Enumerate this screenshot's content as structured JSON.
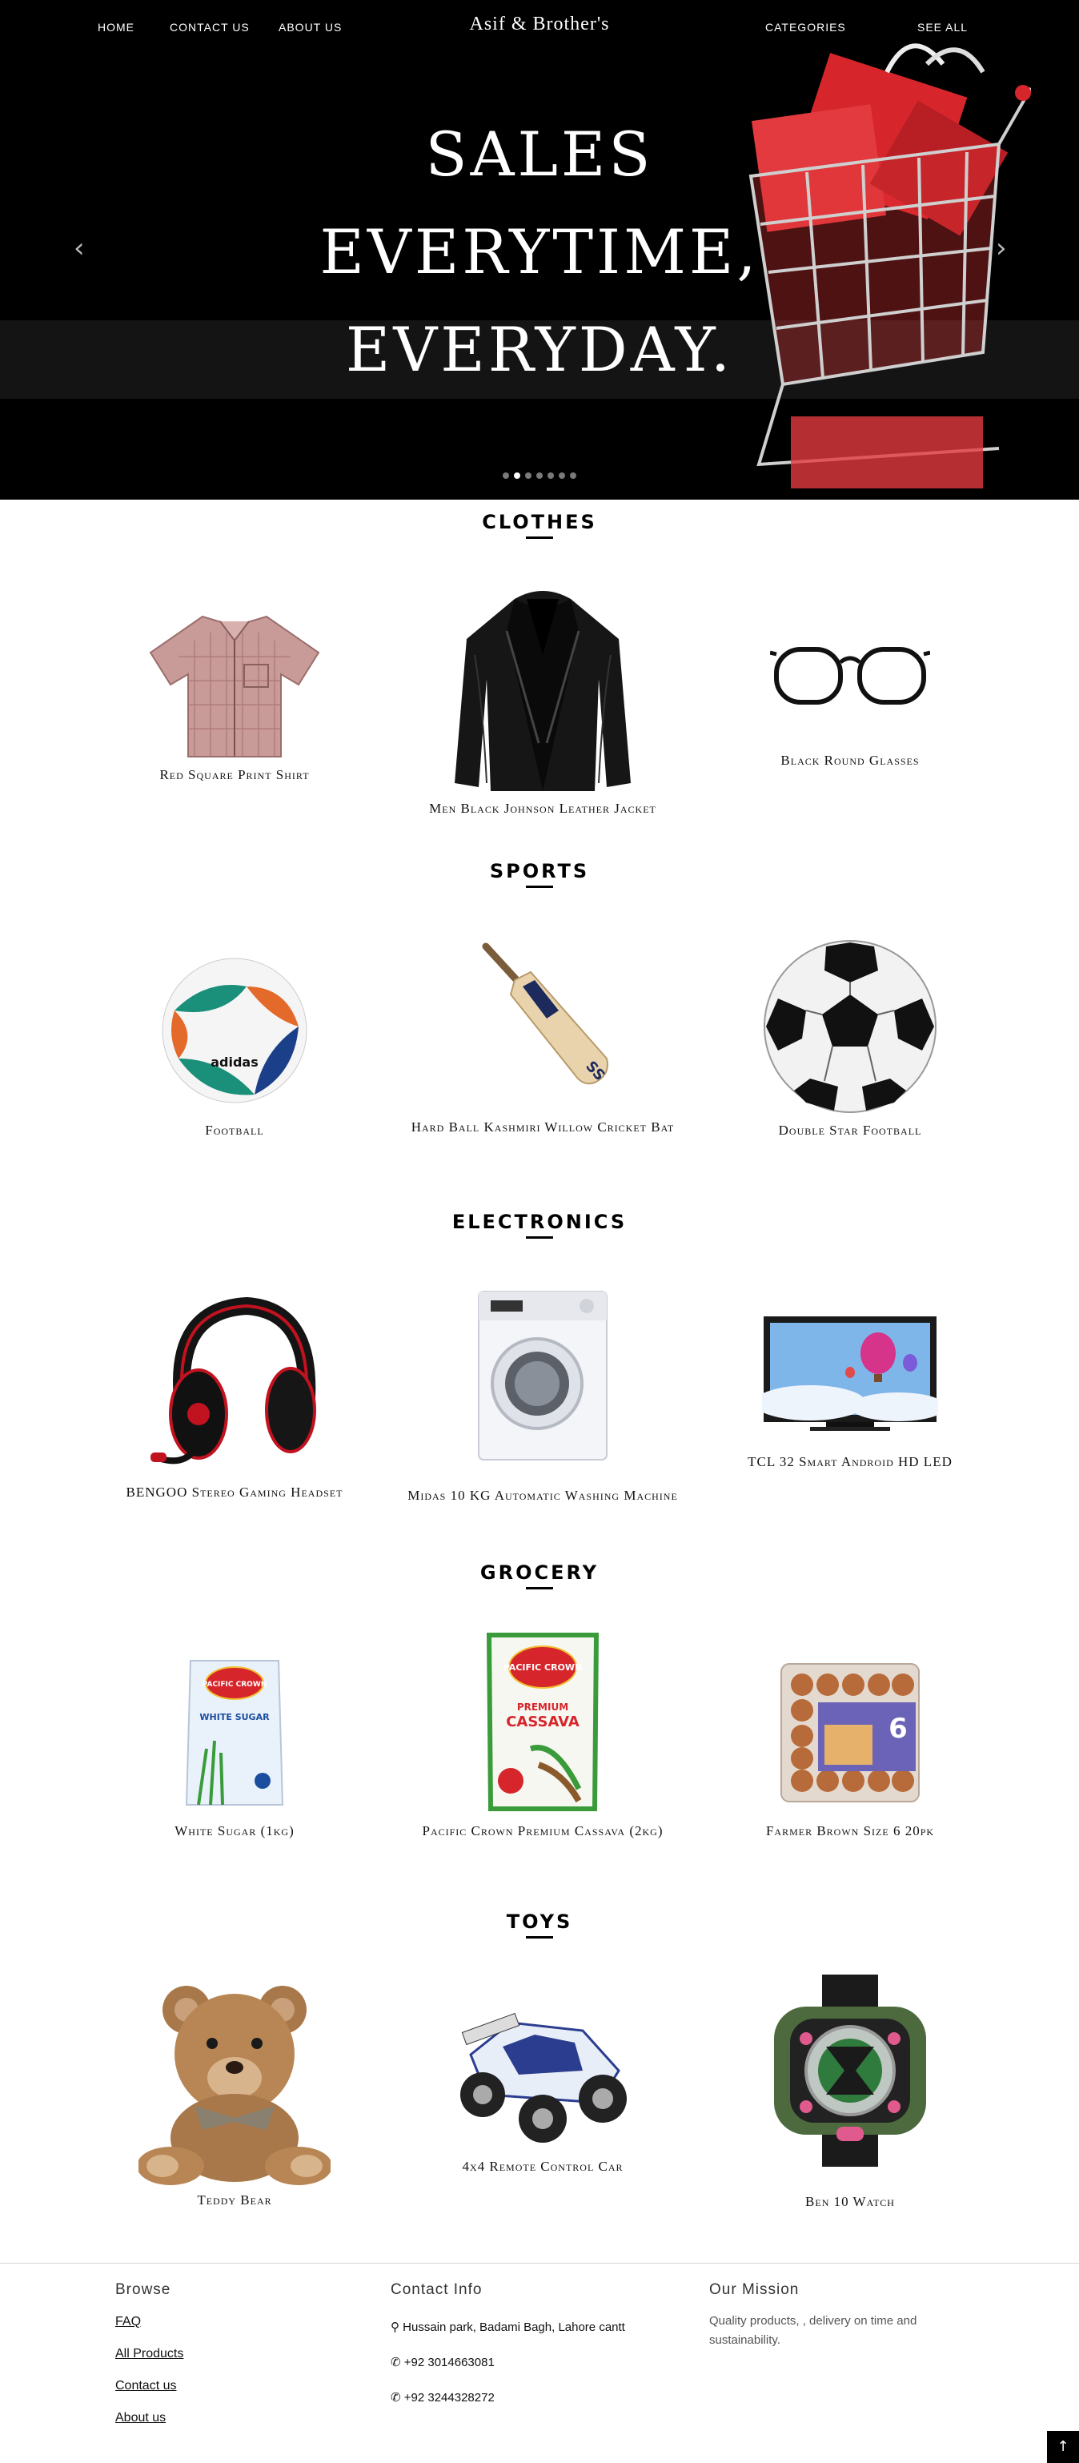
{
  "nav": {
    "home": "HOME",
    "contact": "CONTACT US",
    "about": "ABOUT US",
    "brand": "Asif & Brother's",
    "categories": "CATEGORIES",
    "see_all": "SEE ALL"
  },
  "hero": {
    "line1": "SALES",
    "line2": "EVERYTIME,",
    "line3": "EVERYDAY.",
    "prev_icon": "chevron-left-icon",
    "next_icon": "chevron-right-icon",
    "slide_count": 7,
    "active_slide": 2
  },
  "sections": [
    {
      "title": "CLOTHES",
      "products": [
        {
          "name": "Red Square Print Shirt",
          "icon": "shirt-icon"
        },
        {
          "name": "Men Black Johnson Leather Jacket",
          "icon": "jacket-icon"
        },
        {
          "name": "Black Round Glasses",
          "icon": "glasses-icon"
        }
      ]
    },
    {
      "title": "SPORTS",
      "products": [
        {
          "name": "Football",
          "icon": "football-icon"
        },
        {
          "name": "Hard Ball Kashmiri Willow Cricket Bat",
          "icon": "cricket-bat-icon"
        },
        {
          "name": "Double Star Football",
          "icon": "soccer-ball-icon"
        }
      ]
    },
    {
      "title": "ELECTRONICS",
      "products": [
        {
          "name": "BENGOO Stereo Gaming Headset",
          "icon": "headset-icon"
        },
        {
          "name": "Midas 10 KG Automatic Washing Machine",
          "icon": "washing-machine-icon"
        },
        {
          "name": "TCL 32 Smart Android HD LED",
          "icon": "tv-icon"
        }
      ]
    },
    {
      "title": "GROCERY",
      "products": [
        {
          "name": "White Sugar (1kg)",
          "icon": "sugar-bag-icon"
        },
        {
          "name": "Pacific Crown Premium Cassava (2kg)",
          "icon": "cassava-bag-icon"
        },
        {
          "name": "Farmer Brown Size 6 20pk",
          "icon": "egg-tray-icon"
        }
      ]
    },
    {
      "title": "TOYS",
      "products": [
        {
          "name": "Teddy Bear",
          "icon": "teddy-bear-icon"
        },
        {
          "name": "4x4 Remote Control Car",
          "icon": "rc-car-icon"
        },
        {
          "name": "Ben 10 Watch",
          "icon": "watch-icon"
        }
      ]
    }
  ],
  "product_art_text": {
    "sugar_brand": "PACIFIC CROWN",
    "sugar_label": "WHITE SUGAR",
    "cassava_brand": "PACIFIC CROWN",
    "cassava_premium": "PREMIUM",
    "cassava_label": "CASSAVA",
    "egg_size": "6",
    "bat_brand": "SS",
    "ball_brand": "adidas"
  },
  "footer": {
    "browse": {
      "title": "Browse",
      "links": [
        "FAQ",
        "All Products",
        "Contact us",
        "About us"
      ]
    },
    "contact": {
      "title": "Contact Info",
      "address": "Hussain park, Badami Bagh, Lahore cantt",
      "phone1": "+92 3014663081",
      "phone2": "+92 3244328272"
    },
    "mission": {
      "title": "Our Mission",
      "text": "Quality products, , delivery on time and sustainability."
    },
    "to_top_icon": "arrow-up-icon"
  },
  "colors": {
    "hero_bg": "#000000",
    "cart_red": "#d7262b",
    "text": "#111111"
  }
}
